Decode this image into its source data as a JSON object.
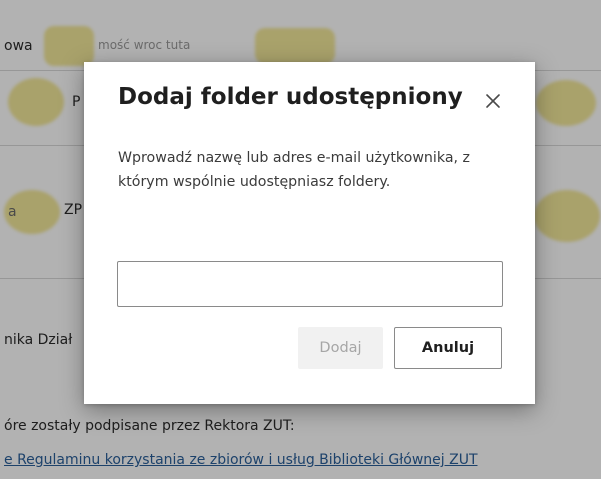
{
  "background": {
    "line_1": "owa",
    "line_1_blurred": "mość wroc tuta",
    "line_2": "P",
    "line_3": "ZP",
    "line_3_prefix": "a",
    "line_4": "nika Dział",
    "line_5": "óre zostały podpisane przez Rektora ZUT:",
    "line_6_link": "e Regulaminu korzystania ze zbiorów i usług Biblioteki Głównej ZUT"
  },
  "dialog": {
    "title": "Dodaj folder udostępniony",
    "description": "Wprowadź nazwę lub adres e-mail użytkownika, z którym wspólnie udostępniasz foldery.",
    "input": {
      "value": "",
      "placeholder": ""
    },
    "add_label": "Dodaj",
    "cancel_label": "Anuluj"
  },
  "icons": {
    "close": "close-icon"
  },
  "colors": {
    "overlay": "#000000",
    "redaction": "#f3e89a",
    "link": "#2a5f9a",
    "disabled_text": "#a6a6a6"
  }
}
